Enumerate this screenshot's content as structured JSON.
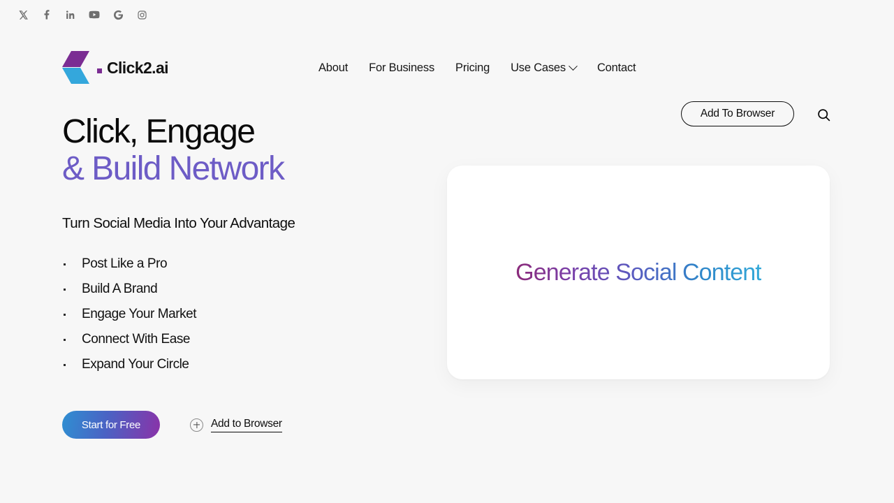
{
  "social_bar": {
    "items": [
      {
        "name": "x-twitter-icon",
        "label": "X"
      },
      {
        "name": "facebook-icon",
        "label": "Facebook"
      },
      {
        "name": "linkedin-icon",
        "label": "LinkedIn"
      },
      {
        "name": "youtube-icon",
        "label": "YouTube"
      },
      {
        "name": "google-icon",
        "label": "Google"
      },
      {
        "name": "instagram-icon",
        "label": "Instagram"
      }
    ]
  },
  "header": {
    "brand": "Click2.ai",
    "nav": [
      {
        "label": "About",
        "has_dropdown": false
      },
      {
        "label": "For Business",
        "has_dropdown": false
      },
      {
        "label": "Pricing",
        "has_dropdown": false
      },
      {
        "label": "Use Cases",
        "has_dropdown": true
      },
      {
        "label": "Contact",
        "has_dropdown": false
      }
    ],
    "add_to_browser_label": "Add To Browser",
    "search_icon": "search-icon"
  },
  "hero": {
    "headline_line1": "Click, Engage",
    "headline_line2": "& Build Network",
    "subhead": "Turn Social Media Into Your Advantage",
    "bullets": [
      "Post Like a Pro",
      "Build A Brand",
      "Engage Your Market",
      "Connect With Ease",
      "Expand Your Circle"
    ],
    "primary_cta": "Start for Free",
    "secondary_cta": "Add to Browser",
    "secondary_cta_icon": "plus-circle-icon",
    "card_headline": "Generate Social Content"
  },
  "colors": {
    "page_background": "#f7f7f7",
    "headline_accent": "#6d5cc6",
    "logo_purple": "#7b2d93",
    "logo_blue": "#34a7dc",
    "cta_gradient_start": "#2f8fd2",
    "cta_gradient_end": "#8a32a8",
    "card_gradient_start": "#8b2b7a",
    "card_gradient_end": "#31a8d8",
    "card_background": "#ffffff"
  }
}
